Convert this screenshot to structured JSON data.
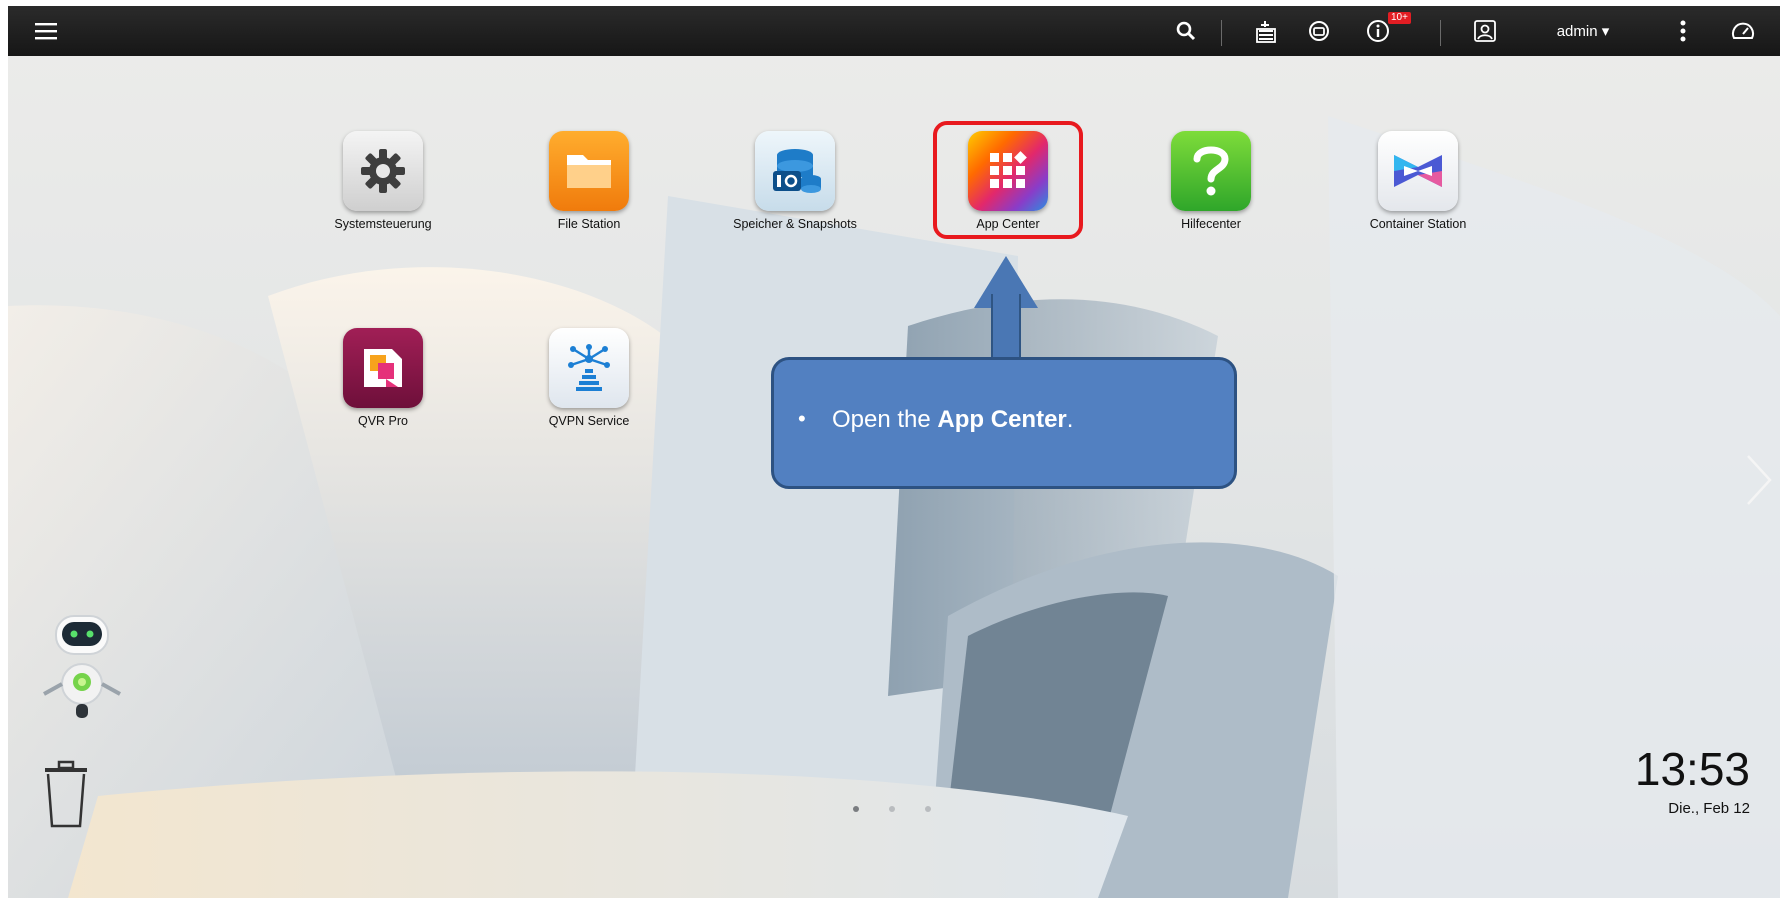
{
  "topbar": {
    "menu_icon": "hamburger-menu-icon",
    "search_icon": "search-icon",
    "background_tasks_icon": "tasks-icon",
    "external_device_icon": "external-device-icon",
    "notifications_icon": "info-icon",
    "notification_badge": "10+",
    "options_icon": "user-options-icon",
    "username": "admin ▾",
    "more_icon": "more-vertical-icon",
    "dashboard_icon": "dashboard-gauge-icon"
  },
  "desktop": {
    "apps_row1": [
      {
        "label": "Systemsteuerung",
        "icon": "gear-icon"
      },
      {
        "label": "File Station",
        "icon": "folder-icon"
      },
      {
        "label": "Speicher & Snapshots",
        "icon": "storage-icon"
      },
      {
        "label": "App Center",
        "icon": "app-grid-icon"
      },
      {
        "label": "Hilfecenter",
        "icon": "question-icon"
      },
      {
        "label": "Container Station",
        "icon": "container-icon"
      }
    ],
    "apps_row2": [
      {
        "label": "QVR Pro",
        "icon": "qvr-icon"
      },
      {
        "label": "QVPN Service",
        "icon": "vpn-icon"
      }
    ]
  },
  "callout": {
    "bullet": "•",
    "prefix": "Open the ",
    "bold": "App Center",
    "suffix": "."
  },
  "clock": {
    "time": "13:53",
    "date": "Die., Feb 12"
  },
  "pager": {
    "pages": 3,
    "active": 1
  },
  "colors": {
    "highlight": "#e8191e",
    "callout": "#5280c1",
    "topbar": "#1c1c1c"
  }
}
